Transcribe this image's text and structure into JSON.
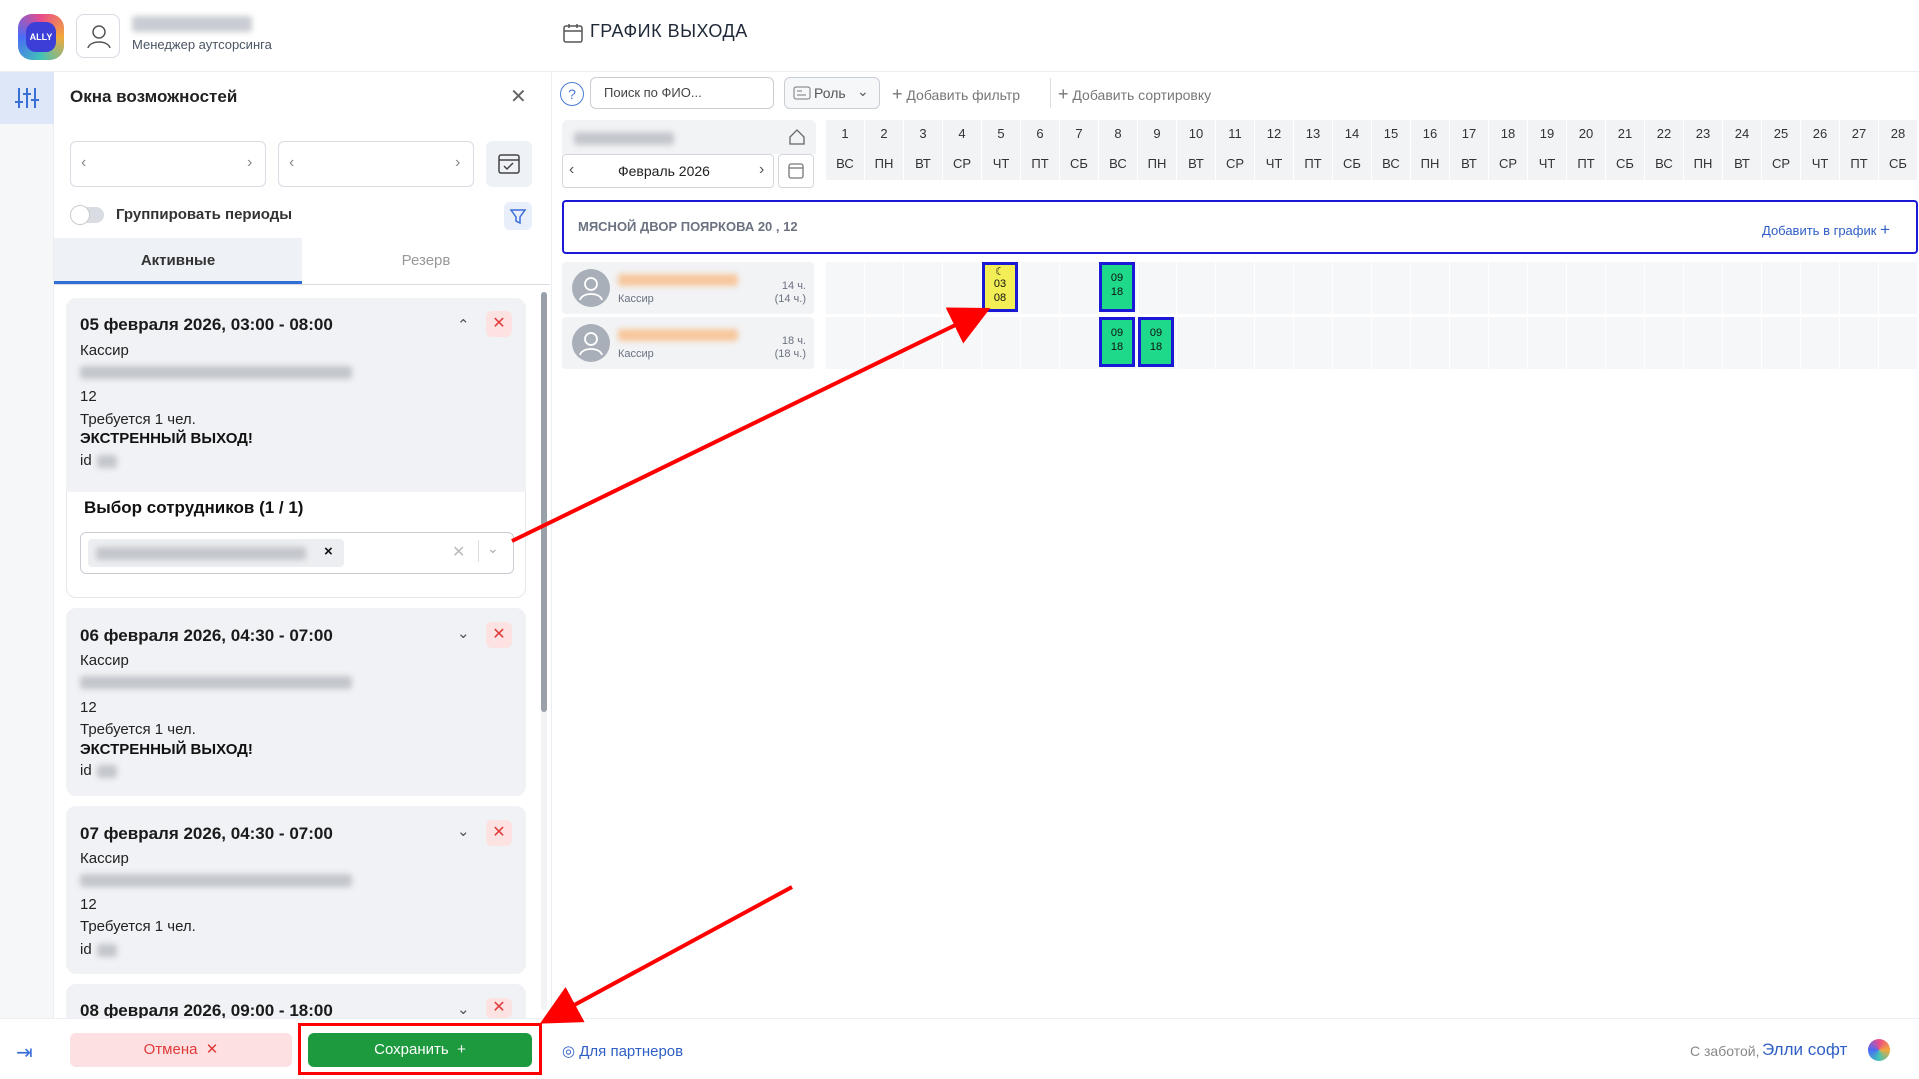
{
  "header": {
    "user_role": "Менеджер аутсорсинга",
    "page_title": "ГРАФИК ВЫХОДА",
    "logo_text": "ALLY"
  },
  "panel": {
    "title": "Окна возможностей",
    "group_periods_label": "Группировать периоды",
    "tabs": [
      {
        "label": "Активные"
      },
      {
        "label": "Резерв"
      }
    ],
    "cards": [
      {
        "title": "05 февраля 2026, 03:00 - 08:00",
        "role": "Кассир",
        "number": "12",
        "required": "Требуется 1 чел.",
        "urgent": "ЭКСТРЕННЫЙ ВЫХОД!",
        "id_label": "id"
      },
      {
        "title": "06 февраля 2026, 04:30 - 07:00",
        "role": "Кассир",
        "number": "12",
        "required": "Требуется 1 чел.",
        "urgent": "ЭКСТРЕННЫЙ ВЫХОД!",
        "id_label": "id"
      },
      {
        "title": "07 февраля 2026, 04:30 - 07:00",
        "role": "Кассир",
        "number": "12",
        "required": "Требуется 1 чел.",
        "id_label": "id"
      },
      {
        "title": "08 февраля 2026, 09:00 - 18:00"
      }
    ],
    "selection_title": "Выбор сотрудников (1 / 1)"
  },
  "footer": {
    "cancel_label": "Отмена",
    "save_label": "Сохранить",
    "partners_label": "Для партнеров",
    "care_label": "С заботой,",
    "care_brand": "Элли софт"
  },
  "toolbar": {
    "search_placeholder": "Поиск по ФИО...",
    "role_label": "Роль",
    "add_filter": "Добавить фильтр",
    "add_sort": "Добавить сортировку"
  },
  "schedule": {
    "month": "Февраль 2026",
    "days": [
      {
        "d": "1",
        "w": "ВС"
      },
      {
        "d": "2",
        "w": "ПН"
      },
      {
        "d": "3",
        "w": "ВТ"
      },
      {
        "d": "4",
        "w": "СР"
      },
      {
        "d": "5",
        "w": "ЧТ"
      },
      {
        "d": "6",
        "w": "ПТ"
      },
      {
        "d": "7",
        "w": "СБ"
      },
      {
        "d": "8",
        "w": "ВС"
      },
      {
        "d": "9",
        "w": "ПН"
      },
      {
        "d": "10",
        "w": "ВТ"
      },
      {
        "d": "11",
        "w": "СР"
      },
      {
        "d": "12",
        "w": "ЧТ"
      },
      {
        "d": "13",
        "w": "ПТ"
      },
      {
        "d": "14",
        "w": "СБ"
      },
      {
        "d": "15",
        "w": "ВС"
      },
      {
        "d": "16",
        "w": "ПН"
      },
      {
        "d": "17",
        "w": "ВТ"
      },
      {
        "d": "18",
        "w": "СР"
      },
      {
        "d": "19",
        "w": "ЧТ"
      },
      {
        "d": "20",
        "w": "ПТ"
      },
      {
        "d": "21",
        "w": "СБ"
      },
      {
        "d": "22",
        "w": "ВС"
      },
      {
        "d": "23",
        "w": "ПН"
      },
      {
        "d": "24",
        "w": "ВТ"
      },
      {
        "d": "25",
        "w": "СР"
      },
      {
        "d": "26",
        "w": "ЧТ"
      },
      {
        "d": "27",
        "w": "ПТ"
      },
      {
        "d": "28",
        "w": "СБ"
      }
    ],
    "shop_name": "МЯСНОЙ ДВОР ПОЯРКОВА 20 , 12",
    "add_to_schedule": "Добавить в график",
    "employees": [
      {
        "role": "Кассир",
        "hours": "14 ч.",
        "hours_sub": "(14 ч.)",
        "shifts": [
          {
            "day": 5,
            "top": "03",
            "bottom": "08",
            "color": "#f3ee55",
            "night": true
          },
          {
            "day": 8,
            "top": "09",
            "bottom": "18",
            "color": "#1fd98a"
          }
        ]
      },
      {
        "role": "Кассир",
        "hours": "18 ч.",
        "hours_sub": "(18 ч.)",
        "shifts": [
          {
            "day": 8,
            "top": "09",
            "bottom": "18",
            "color": "#1fd98a"
          },
          {
            "day": 9,
            "top": "09",
            "bottom": "18",
            "color": "#1fd98a"
          }
        ]
      }
    ]
  },
  "colors": {
    "accent": "#2f5fc4",
    "save": "#1e9a3e",
    "cancel_bg": "#fde0e1",
    "annotation": "#ff0000"
  },
  "icons": [
    "calendar-icon",
    "sliders-icon",
    "close-icon",
    "chevron-left-icon",
    "chevron-right-icon",
    "filter-icon",
    "help-icon",
    "plus-icon",
    "home-icon",
    "moon-icon",
    "exit-icon"
  ]
}
